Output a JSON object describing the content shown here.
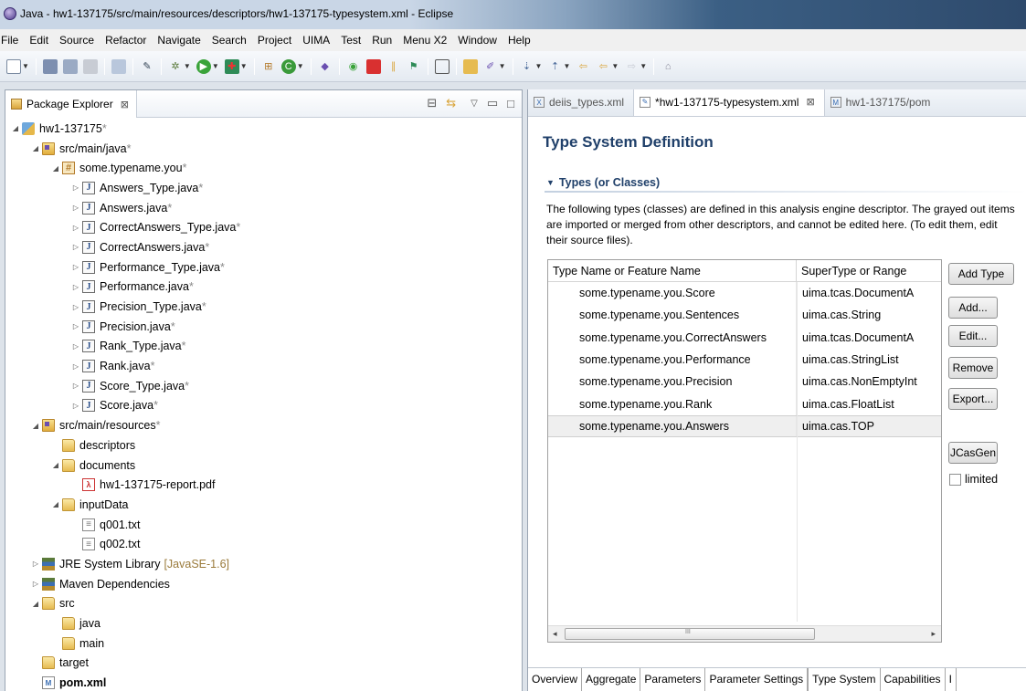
{
  "window": {
    "title": "Java - hw1-137175/src/main/resources/descriptors/hw1-137175-typesystem.xml - Eclipse"
  },
  "menu": [
    "File",
    "Edit",
    "Source",
    "Refactor",
    "Navigate",
    "Search",
    "Project",
    "UIMA",
    "Test",
    "Run",
    "Menu X2",
    "Window",
    "Help"
  ],
  "package_explorer": {
    "tab_label": "Package Explorer",
    "close_glyph": "⊠",
    "tree": [
      {
        "label": "hw1-137175",
        "dirty": "*",
        "icon": "project-icon",
        "twisty": "◢",
        "indent": 0
      },
      {
        "label": "src/main/java",
        "dirty": "*",
        "icon": "source-folder-icon",
        "twisty": "◢",
        "indent": 1
      },
      {
        "label": "some.typename.you",
        "dirty": "*",
        "icon": "package-icon",
        "twisty": "◢",
        "indent": 2
      },
      {
        "label": "Answers_Type.java",
        "dirty": "*",
        "icon": "java-file-icon",
        "twisty": "▷",
        "indent": 3
      },
      {
        "label": "Answers.java",
        "dirty": "*",
        "icon": "java-file-icon",
        "twisty": "▷",
        "indent": 3
      },
      {
        "label": "CorrectAnswers_Type.java",
        "dirty": "*",
        "icon": "java-file-icon",
        "twisty": "▷",
        "indent": 3
      },
      {
        "label": "CorrectAnswers.java",
        "dirty": "*",
        "icon": "java-file-icon",
        "twisty": "▷",
        "indent": 3
      },
      {
        "label": "Performance_Type.java",
        "dirty": "*",
        "icon": "java-file-icon",
        "twisty": "▷",
        "indent": 3
      },
      {
        "label": "Performance.java",
        "dirty": "*",
        "icon": "java-file-icon",
        "twisty": "▷",
        "indent": 3
      },
      {
        "label": "Precision_Type.java",
        "dirty": "*",
        "icon": "java-file-icon",
        "twisty": "▷",
        "indent": 3
      },
      {
        "label": "Precision.java",
        "dirty": "*",
        "icon": "java-file-icon",
        "twisty": "▷",
        "indent": 3
      },
      {
        "label": "Rank_Type.java",
        "dirty": "*",
        "icon": "java-file-icon",
        "twisty": "▷",
        "indent": 3
      },
      {
        "label": "Rank.java",
        "dirty": "*",
        "icon": "java-file-icon",
        "twisty": "▷",
        "indent": 3
      },
      {
        "label": "Score_Type.java",
        "dirty": "*",
        "icon": "java-file-icon",
        "twisty": "▷",
        "indent": 3
      },
      {
        "label": "Score.java",
        "dirty": "*",
        "icon": "java-file-icon",
        "twisty": "▷",
        "indent": 3
      },
      {
        "label": "src/main/resources",
        "dirty": "*",
        "icon": "source-folder-icon",
        "twisty": "◢",
        "indent": 1
      },
      {
        "label": "descriptors",
        "dirty": "",
        "icon": "folder-icon",
        "twisty": "",
        "indent": 2
      },
      {
        "label": "documents",
        "dirty": "",
        "icon": "folder-icon",
        "twisty": "◢",
        "indent": 2
      },
      {
        "label": "hw1-137175-report.pdf",
        "dirty": "",
        "icon": "pdf-file-icon",
        "twisty": "",
        "indent": 3
      },
      {
        "label": "inputData",
        "dirty": "",
        "icon": "folder-icon",
        "twisty": "◢",
        "indent": 2
      },
      {
        "label": "q001.txt",
        "dirty": "",
        "icon": "text-file-icon",
        "twisty": "",
        "indent": 3
      },
      {
        "label": "q002.txt",
        "dirty": "",
        "icon": "text-file-icon",
        "twisty": "",
        "indent": 3
      },
      {
        "label": "JRE System Library",
        "dirty": "",
        "suffix": "[JavaSE-1.6]",
        "icon": "library-icon",
        "twisty": "▷",
        "indent": 1
      },
      {
        "label": "Maven Dependencies",
        "dirty": "",
        "icon": "library-icon",
        "twisty": "▷",
        "indent": 1
      },
      {
        "label": "src",
        "dirty": "",
        "icon": "folder-icon",
        "twisty": "◢",
        "indent": 1
      },
      {
        "label": "java",
        "dirty": "",
        "icon": "folder-icon",
        "twisty": "",
        "indent": 2
      },
      {
        "label": "main",
        "dirty": "",
        "icon": "folder-icon",
        "twisty": "",
        "indent": 2
      },
      {
        "label": "target",
        "dirty": "",
        "icon": "folder-icon",
        "twisty": "",
        "indent": 1
      },
      {
        "label": "pom.xml",
        "dirty": "",
        "icon": "xml-file-icon",
        "twisty": "",
        "indent": 1,
        "bold": true
      }
    ]
  },
  "editor": {
    "tabs": [
      {
        "label": "deiis_types.xml",
        "icon": "X",
        "active": false
      },
      {
        "label": "*hw1-137175-typesystem.xml",
        "icon": "✎",
        "active": true
      },
      {
        "label": "hw1-137175/pom",
        "icon": "M",
        "active": false
      }
    ],
    "close_glyph": "⊠",
    "page_title": "Type System Definition",
    "section_title": "Types (or Classes)",
    "section_desc": "The following types (classes) are defined in this analysis engine descriptor. The grayed out items are imported or merged from other descriptors, and cannot be edited here. (To edit them, edit their source files).",
    "table": {
      "headers": [
        "Type Name or Feature Name",
        "SuperType or Range"
      ],
      "rows": [
        [
          "some.typename.you.Score",
          "uima.tcas.DocumentA"
        ],
        [
          "some.typename.you.Sentences",
          "uima.cas.String"
        ],
        [
          "some.typename.you.CorrectAnswers",
          "uima.tcas.DocumentA"
        ],
        [
          "some.typename.you.Performance",
          "uima.cas.StringList"
        ],
        [
          "some.typename.you.Precision",
          "uima.cas.NonEmptyInt"
        ],
        [
          "some.typename.you.Rank",
          "uima.cas.FloatList"
        ],
        [
          "some.typename.you.Answers",
          "uima.cas.TOP"
        ]
      ],
      "selected_row": 6,
      "scroll_left": "◂",
      "scroll_right": "▸",
      "scroll_grip": "III"
    },
    "buttons": {
      "add_type": "Add Type",
      "add": "Add...",
      "edit": "Edit...",
      "remove": "Remove",
      "export": "Export...",
      "jcasgen": "JCasGen"
    },
    "limited_label": "limited",
    "bottom_tabs": [
      "Overview",
      "Aggregate",
      "Parameters",
      "Parameter Settings",
      "Type System",
      "Capabilities",
      "I"
    ],
    "active_bottom_tab": 4
  }
}
